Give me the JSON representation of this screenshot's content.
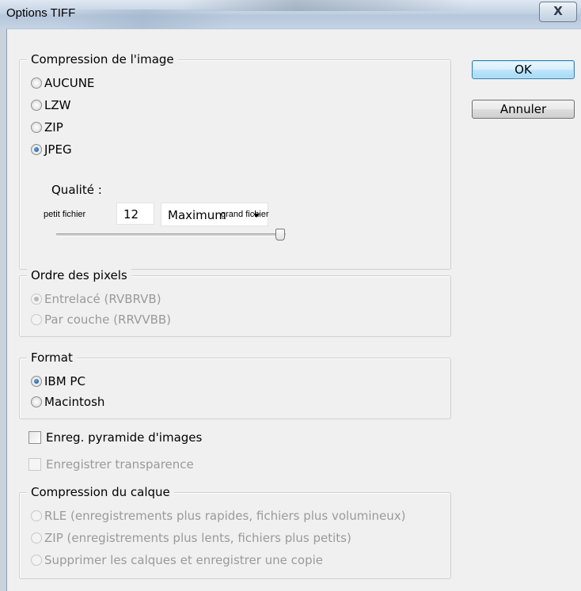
{
  "window": {
    "title": "Options TIFF",
    "close_label": "X"
  },
  "buttons": {
    "ok": "OK",
    "cancel": "Annuler"
  },
  "image_compression": {
    "legend": "Compression de l'image",
    "options": [
      "AUCUNE",
      "LZW",
      "ZIP",
      "JPEG"
    ],
    "selected": "JPEG",
    "quality_label": "Qualité :",
    "quality_value": "12",
    "quality_preset": "Maximum",
    "slider_min_label": "petit fichier",
    "slider_max_label": "grand fichier",
    "slider_value": 12,
    "slider_max": 12
  },
  "pixel_order": {
    "legend": "Ordre des pixels",
    "options": [
      "Entrelacé (RVBRVB)",
      "Par couche (RRVVBB)"
    ],
    "selected": "Entrelacé (RVBRVB)",
    "enabled": false
  },
  "format": {
    "legend": "Format",
    "options": [
      "IBM PC",
      "Macintosh"
    ],
    "selected": "IBM PC"
  },
  "checkboxes": {
    "pyramid": "Enreg. pyramide d'images",
    "transparency": "Enregistrer transparence"
  },
  "layer_compression": {
    "legend": "Compression du calque",
    "options": [
      "RLE (enregistrements plus rapides, fichiers plus volumineux)",
      "ZIP (enregistrements plus lents, fichiers plus petits)",
      "Supprimer les calques et enregistrer une copie"
    ],
    "enabled": false
  },
  "colors": {
    "accent": "#1f5faf",
    "disabled_text": "#9a9a9a"
  }
}
